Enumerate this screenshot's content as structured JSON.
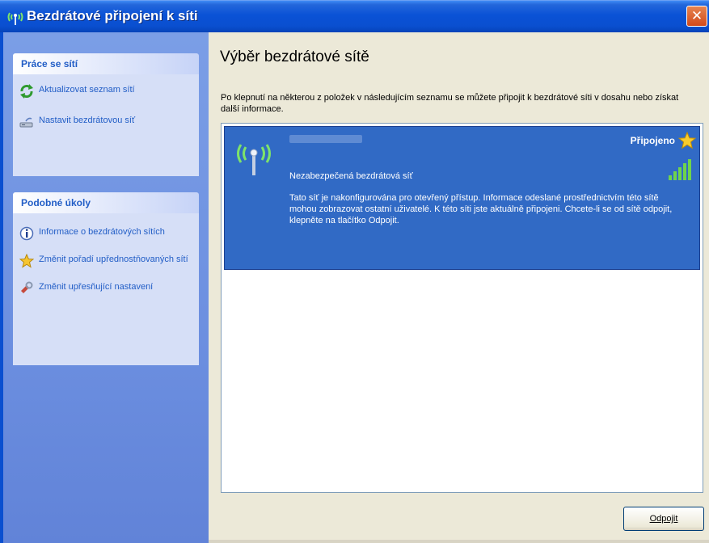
{
  "window": {
    "title": "Bezdrátové připojení k síti",
    "close_glyph": "✕"
  },
  "sidebar": {
    "network_tasks": {
      "header": "Práce se sítí",
      "items": [
        {
          "label": "Aktualizovat seznam sítí",
          "icon": "refresh-icon"
        },
        {
          "label": "Nastavit bezdrátovou síť",
          "icon": "wireless-setup-icon"
        }
      ]
    },
    "related_tasks": {
      "header": "Podobné úkoly",
      "items": [
        {
          "label": "Informace o bezdrátových sítích",
          "icon": "info-icon"
        },
        {
          "label": "Změnit pořadí upřednostňovaných sítí",
          "icon": "star-icon"
        },
        {
          "label": "Změnit upřesňující nastavení",
          "icon": "settings-icon"
        }
      ]
    }
  },
  "main": {
    "heading": "Výběr bezdrátové sítě",
    "intro": "Po klepnutí na některou z položek v následujícím seznamu se můžete připojit k bezdrátové síti v dosahu nebo získat další informace.",
    "networks": [
      {
        "status": "Připojeno",
        "security": "Nezabezpečená bezdrátová síť",
        "description": "Tato síť je nakonfigurována pro otevřený přístup. Informace odeslané prostřednictvím této sítě mohou zobrazovat ostatní uživatelé. K této síti jste aktuálně připojeni. Chcete-li se od sítě odpojit, klepněte na tlačítko Odpojit.",
        "signal_bars": 5,
        "signal_max": 5
      }
    ],
    "disconnect_button": "Odpojit"
  },
  "colors": {
    "titlebar": "#0a52d6",
    "sidebar": "#6c8fe0",
    "task_link": "#215dc6",
    "selection": "#316ac5",
    "signal": "#6fd44b"
  }
}
